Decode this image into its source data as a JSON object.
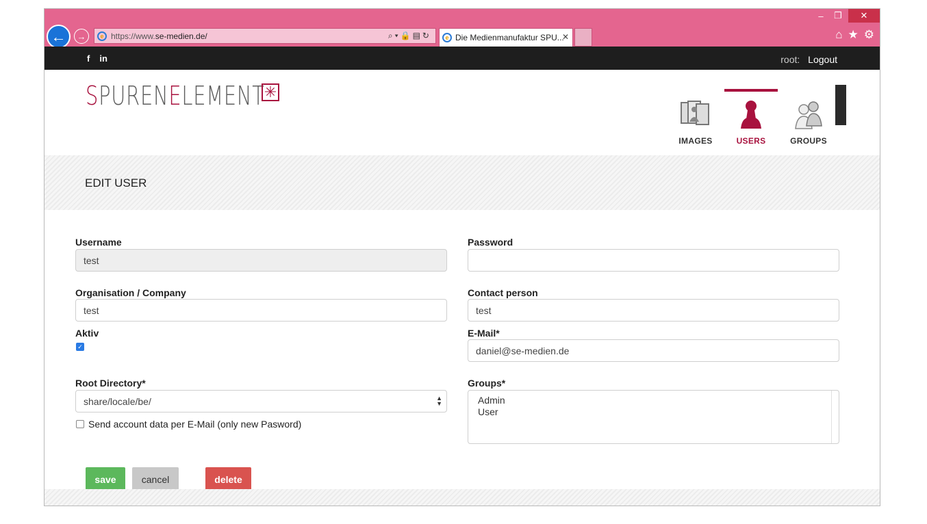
{
  "browser": {
    "url_prefix": "https://www.",
    "url_host": "se-medien.de/",
    "tab_title": "Die Medienmanufaktur SPU...",
    "min_glyph": "‒",
    "max_glyph": "❐",
    "close_glyph": "✕",
    "back_glyph": "←",
    "forward_glyph": "→",
    "addr_tools": "⌕▾🔒▤↻",
    "tab_close_glyph": "✕",
    "home_glyph": "⌂",
    "star_glyph": "★",
    "gear_glyph": "⚙"
  },
  "topbar": {
    "facebook": "f",
    "linkedin": "in",
    "user_label": "root:",
    "logout": "Logout"
  },
  "logo": {
    "s": "S",
    "part1": "PUREN",
    "e": "E",
    "part2": "LEMENT",
    "mark": "✳"
  },
  "nav": {
    "images": "IMAGES",
    "users": "USERS",
    "groups": "GROUPS"
  },
  "page": {
    "title": "EDIT USER"
  },
  "form": {
    "username_label": "Username",
    "username_value": "test",
    "password_label": "Password",
    "password_value": "",
    "organisation_label": "Organisation / Company",
    "organisation_value": "test",
    "contact_label": "Contact person",
    "contact_value": "test",
    "aktiv_label": "Aktiv",
    "aktiv_checked": true,
    "email_label": "E-Mail*",
    "email_value": "daniel@se-medien.de",
    "root_dir_label": "Root Directory*",
    "root_dir_value": "share/locale/be/",
    "groups_label": "Groups*",
    "groups_options": [
      "Admin",
      "User"
    ],
    "send_account_label": "Send account data per E-Mail (only new Pasword)",
    "send_account_checked": false
  },
  "buttons": {
    "save": "save",
    "cancel": "cancel",
    "delete": "delete"
  },
  "colors": {
    "chrome_pink": "#e4658f",
    "brand": "#a8123e",
    "save_green": "#5cb85c",
    "delete_red": "#d9534f"
  }
}
